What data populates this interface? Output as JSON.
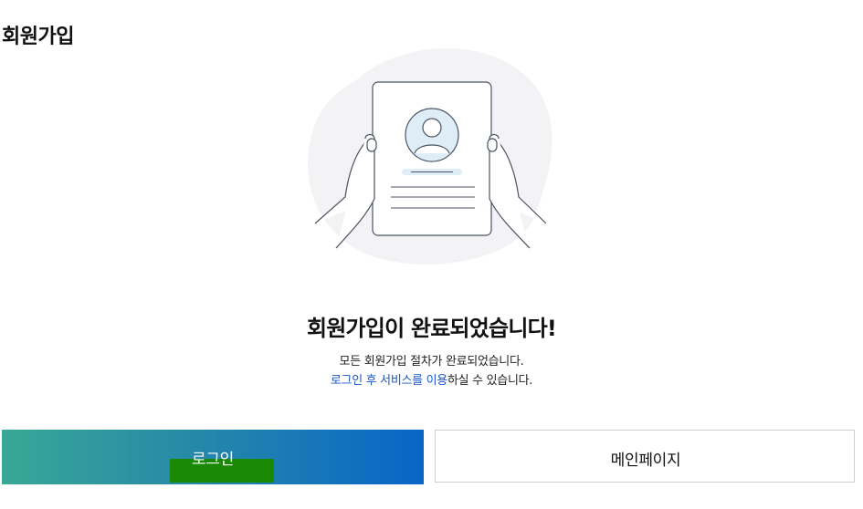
{
  "header": {
    "title": "회원가입"
  },
  "illustration": {
    "icon": "document-with-profile-icon"
  },
  "message": {
    "headline": "회원가입이 완료되었습니다!",
    "line1": "모든 회원가입 절차가 완료되었습니다.",
    "line2_accent": "로그인 후 서비스를 이용",
    "line2_rest": "하실 수 있습니다."
  },
  "buttons": {
    "login_label": "로그인",
    "main_label": "메인페이지"
  },
  "colors": {
    "highlight": "#ffff00",
    "accent_text": "#1a56c4",
    "login_gradient_start": "#3aa796",
    "login_gradient_end": "#0a64c8",
    "overlay_green": "#1a8a06"
  }
}
